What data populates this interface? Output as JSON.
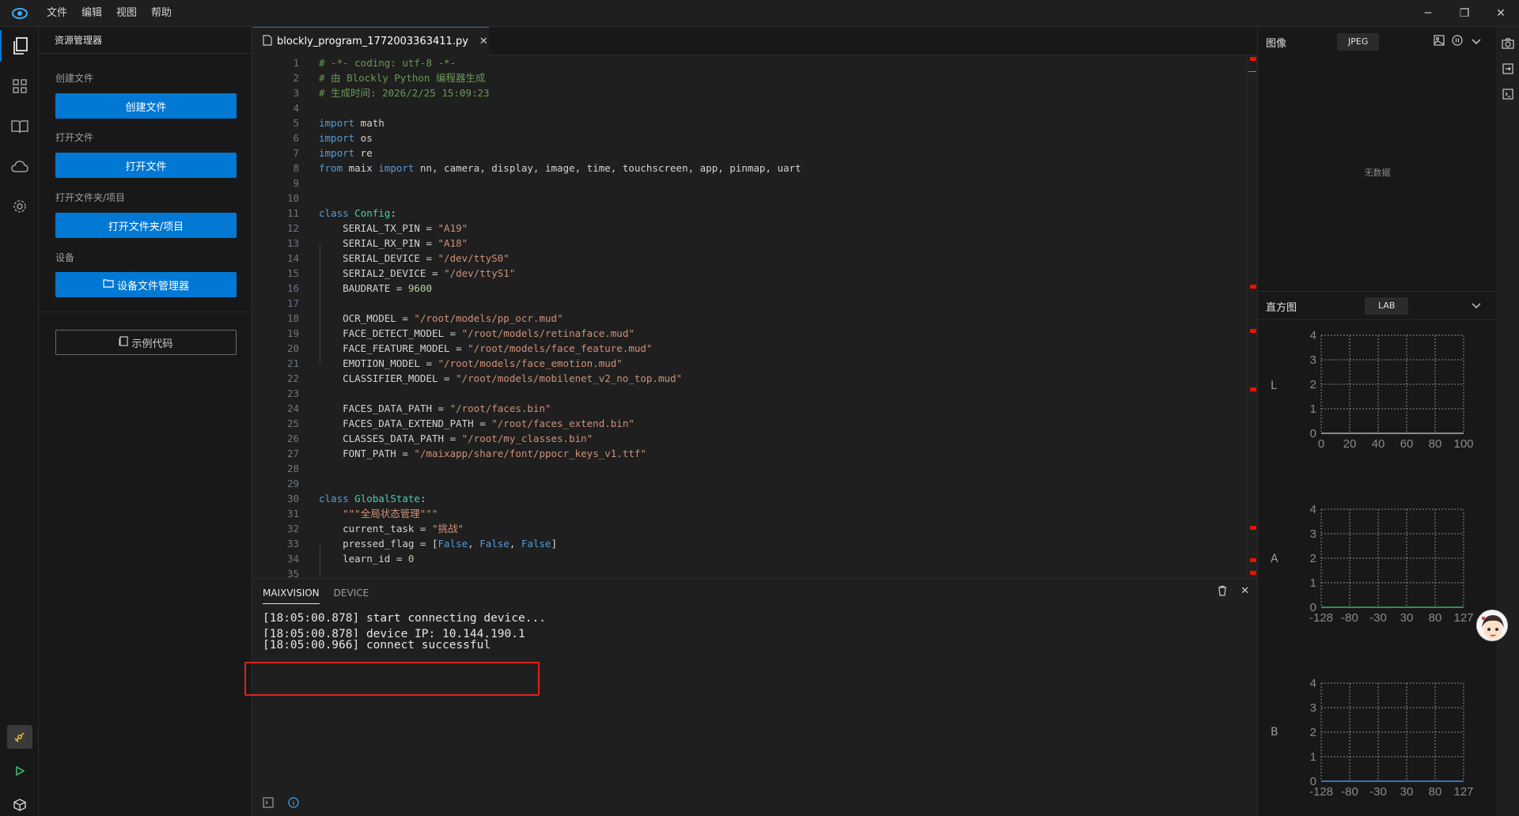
{
  "menu": [
    "文件",
    "编辑",
    "视图",
    "帮助"
  ],
  "sidebar": {
    "title": "资源管理器",
    "create_label": "创建文件",
    "create_button": "创建文件",
    "open_label": "打开文件",
    "open_button": "打开文件",
    "folder_label": "打开文件夹/项目",
    "folder_button": "打开文件夹/项目",
    "device_label": "设备",
    "device_button": "设备文件管理器",
    "example_button": "示例代码"
  },
  "editor": {
    "tab_title": "blockly_program_1772003363411.py",
    "code": [
      "# -*- coding: utf-8 -*-",
      "# 由 Blockly Python 编程器生成",
      "# 生成时间: 2026/2/25 15:09:23",
      "",
      "import math",
      "import os",
      "import re",
      "from maix import nn, camera, display, image, time, touchscreen, app, pinmap, uart",
      "",
      "",
      "class Config:",
      "    SERIAL_TX_PIN = \"A19\"",
      "    SERIAL_RX_PIN = \"A18\"",
      "    SERIAL_DEVICE = \"/dev/ttyS0\"",
      "    SERIAL2_DEVICE = \"/dev/ttyS1\"",
      "    BAUDRATE = 9600",
      "",
      "    OCR_MODEL = \"/root/models/pp_ocr.mud\"",
      "    FACE_DETECT_MODEL = \"/root/models/retinaface.mud\"",
      "    FACE_FEATURE_MODEL = \"/root/models/face_feature.mud\"",
      "    EMOTION_MODEL = \"/root/models/face_emotion.mud\"",
      "    CLASSIFIER_MODEL = \"/root/models/mobilenet_v2_no_top.mud\"",
      "",
      "    FACES_DATA_PATH = \"/root/faces.bin\"",
      "    FACES_DATA_EXTEND_PATH = \"/root/faces_extend.bin\"",
      "    CLASSES_DATA_PATH = \"/root/my_classes.bin\"",
      "    FONT_PATH = \"/maixapp/share/font/ppocr_keys_v1.ttf\"",
      "",
      "",
      "class GlobalState:",
      "    \"\"\"全局状态管理\"\"\"",
      "    current_task = \"挑战\"",
      "    pressed_flag = [False, False, False]",
      "    learn_id = 0",
      ""
    ]
  },
  "panel": {
    "tabs": [
      "MAIXVISION",
      "DEVICE"
    ],
    "log": [
      "[18:05:00.878] start connecting device...",
      "[18:05:00.878] device IP: 10.144.190.1",
      "[18:05:00.966] connect successful"
    ]
  },
  "right": {
    "image_title": "图像",
    "image_format": "JPEG",
    "no_data": "无数据",
    "hist_title": "直方图",
    "hist_mode": "LAB",
    "hist_y_ticks": [
      "0",
      "1",
      "2",
      "3",
      "4"
    ],
    "channels": [
      {
        "label": "L",
        "x_ticks": [
          "0",
          "20",
          "40",
          "60",
          "80",
          "100"
        ],
        "color": "#b0b0b0"
      },
      {
        "label": "A",
        "x_ticks": [
          "-128",
          "-80",
          "-30",
          "30",
          "80",
          "127"
        ],
        "color": "#3cb371"
      },
      {
        "label": "B",
        "x_ticks": [
          "-128",
          "-80",
          "-30",
          "30",
          "80",
          "127"
        ],
        "color": "#4a90e2"
      }
    ]
  },
  "colors": {
    "accent": "#0078d4",
    "error": "#e51400",
    "highlight": "#e02020"
  }
}
